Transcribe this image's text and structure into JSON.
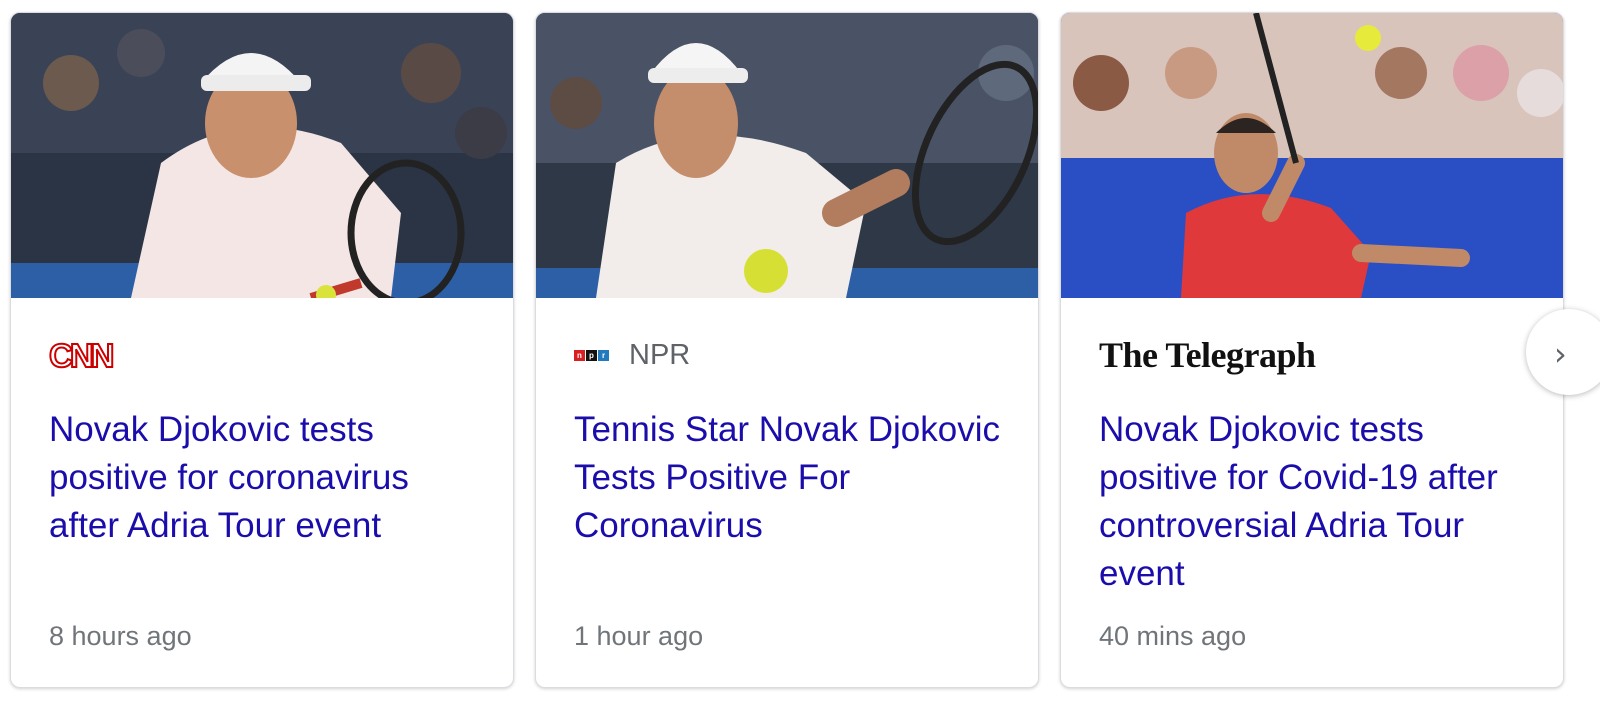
{
  "cards": [
    {
      "source": "CNN",
      "headline": "Novak Djokovic tests positive for coronavirus after Adria Tour event",
      "time": "8 hours ago"
    },
    {
      "source": "NPR",
      "headline": "Tennis Star Novak Djokovic Tests Positive For Coronavirus",
      "time": "1 hour ago"
    },
    {
      "source": "The Telegraph",
      "headline": "Novak Djokovic tests positive for Covid-19 after controversial Adria Tour event",
      "time": "40 mins ago"
    }
  ],
  "next_button": {
    "icon": "chevron-right-icon",
    "glyph": "›"
  },
  "colors": {
    "headline": "#1a0dab",
    "meta": "#70757a",
    "cnn_red": "#cc0000",
    "court_blue": "#2a4fc4"
  }
}
